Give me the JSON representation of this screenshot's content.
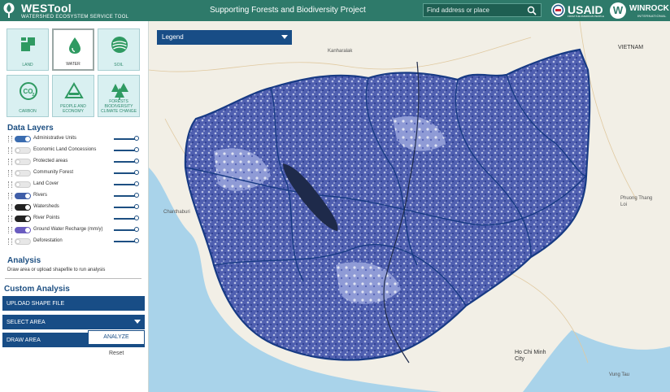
{
  "header": {
    "app_title": "WESTool",
    "app_subtitle": "WATERSHED ECOSYSTEM SERVICE TOOL",
    "project_title": "Supporting Forests and Biodiversity Project",
    "search_placeholder": "Find address or place",
    "usaid_label": "USAID",
    "usaid_sub": "FROM THE AMERICAN PEOPLE",
    "winrock_label": "WINROCK",
    "winrock_sub": "INTERNATIONAL",
    "color": "#2e7a6a"
  },
  "tiles": [
    {
      "label": "LAND",
      "icon": "land-icon",
      "active": false
    },
    {
      "label": "WATER",
      "icon": "water-drop-icon",
      "active": true
    },
    {
      "label": "SOIL",
      "icon": "soil-icon",
      "active": false
    },
    {
      "label": "CARBON",
      "icon": "co2-icon",
      "active": false
    },
    {
      "label": "PEOPLE AND ECONOMY",
      "icon": "people-icon",
      "active": false
    },
    {
      "label": "FORESTS BIODIVERSITY CLIMATE CHANGE",
      "icon": "trees-icon",
      "active": false
    }
  ],
  "data_layers": {
    "title": "Data Layers",
    "items": [
      {
        "label": "Administrative Units",
        "on": true,
        "color": "#3a6cb0"
      },
      {
        "label": "Economic Land Concessions",
        "on": false,
        "color": "#e7e7e7"
      },
      {
        "label": "Protected areas",
        "on": false,
        "color": "#e7e7e7"
      },
      {
        "label": "Community Forest",
        "on": false,
        "color": "#e7e7e7"
      },
      {
        "label": "Land Cover",
        "on": false,
        "color": "#e7e7e7"
      },
      {
        "label": "Rivers",
        "on": true,
        "color": "#3f5ea8"
      },
      {
        "label": "Watersheds",
        "on": true,
        "color": "#222222"
      },
      {
        "label": "River Points",
        "on": true,
        "color": "#222222"
      },
      {
        "label": "Ground Water Recharge (mm/y)",
        "on": true,
        "color": "#6a5cc0"
      },
      {
        "label": "Deforestation",
        "on": false,
        "color": "#e7e7e7"
      }
    ]
  },
  "analysis": {
    "title": "Analysis",
    "hint": "Draw area or upload shapefile to run analysis"
  },
  "custom_analysis": {
    "title": "Custom Analysis",
    "upload_label": "UPLOAD SHAPE FILE",
    "select_area_label": "SELECT AREA",
    "draw_area_label": "DRAW AREA",
    "analyze_label": "ANALYZE",
    "reset_label": "Reset"
  },
  "map": {
    "legend_label": "Legend",
    "places": [
      {
        "label": "VIETNAM"
      },
      {
        "label": "Kanharalak"
      },
      {
        "label": "Phuong Thang Loi"
      },
      {
        "label": "Chanthaburi"
      },
      {
        "label": "Ho Chi Minh City"
      },
      {
        "label": "Vung Tau"
      }
    ]
  }
}
